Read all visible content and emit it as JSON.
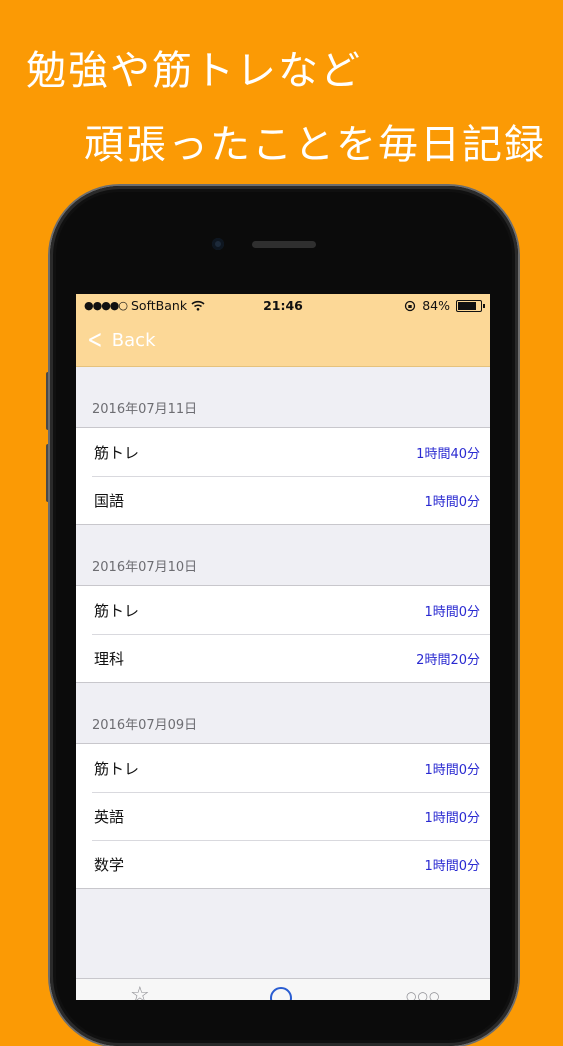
{
  "promo": {
    "line1": "勉強や筋トレなど",
    "line2": "頑張ったことを毎日記録"
  },
  "status_bar": {
    "signal_dots": "●●●●○",
    "carrier": "SoftBank",
    "time": "21:46",
    "battery": "84%",
    "battery_level": 0.84
  },
  "nav": {
    "back_label": "Back"
  },
  "sections": [
    {
      "date": "2016年07月11日",
      "rows": [
        {
          "subject": "筋トレ",
          "duration": "1時間40分"
        },
        {
          "subject": "国語",
          "duration": "1時間0分"
        }
      ]
    },
    {
      "date": "2016年07月10日",
      "rows": [
        {
          "subject": "筋トレ",
          "duration": "1時間0分"
        },
        {
          "subject": "理科",
          "duration": "2時間20分"
        }
      ]
    },
    {
      "date": "2016年07月09日",
      "rows": [
        {
          "subject": "筋トレ",
          "duration": "1時間0分"
        },
        {
          "subject": "英語",
          "duration": "1時間0分"
        },
        {
          "subject": "数学",
          "duration": "1時間0分"
        }
      ]
    }
  ],
  "tabbar": {
    "star_icon": "☆",
    "more_icon": "○○○"
  },
  "colors": {
    "background": "#FB9A05",
    "nav": "#FCD897",
    "duration_text": "#2a2ad1"
  }
}
